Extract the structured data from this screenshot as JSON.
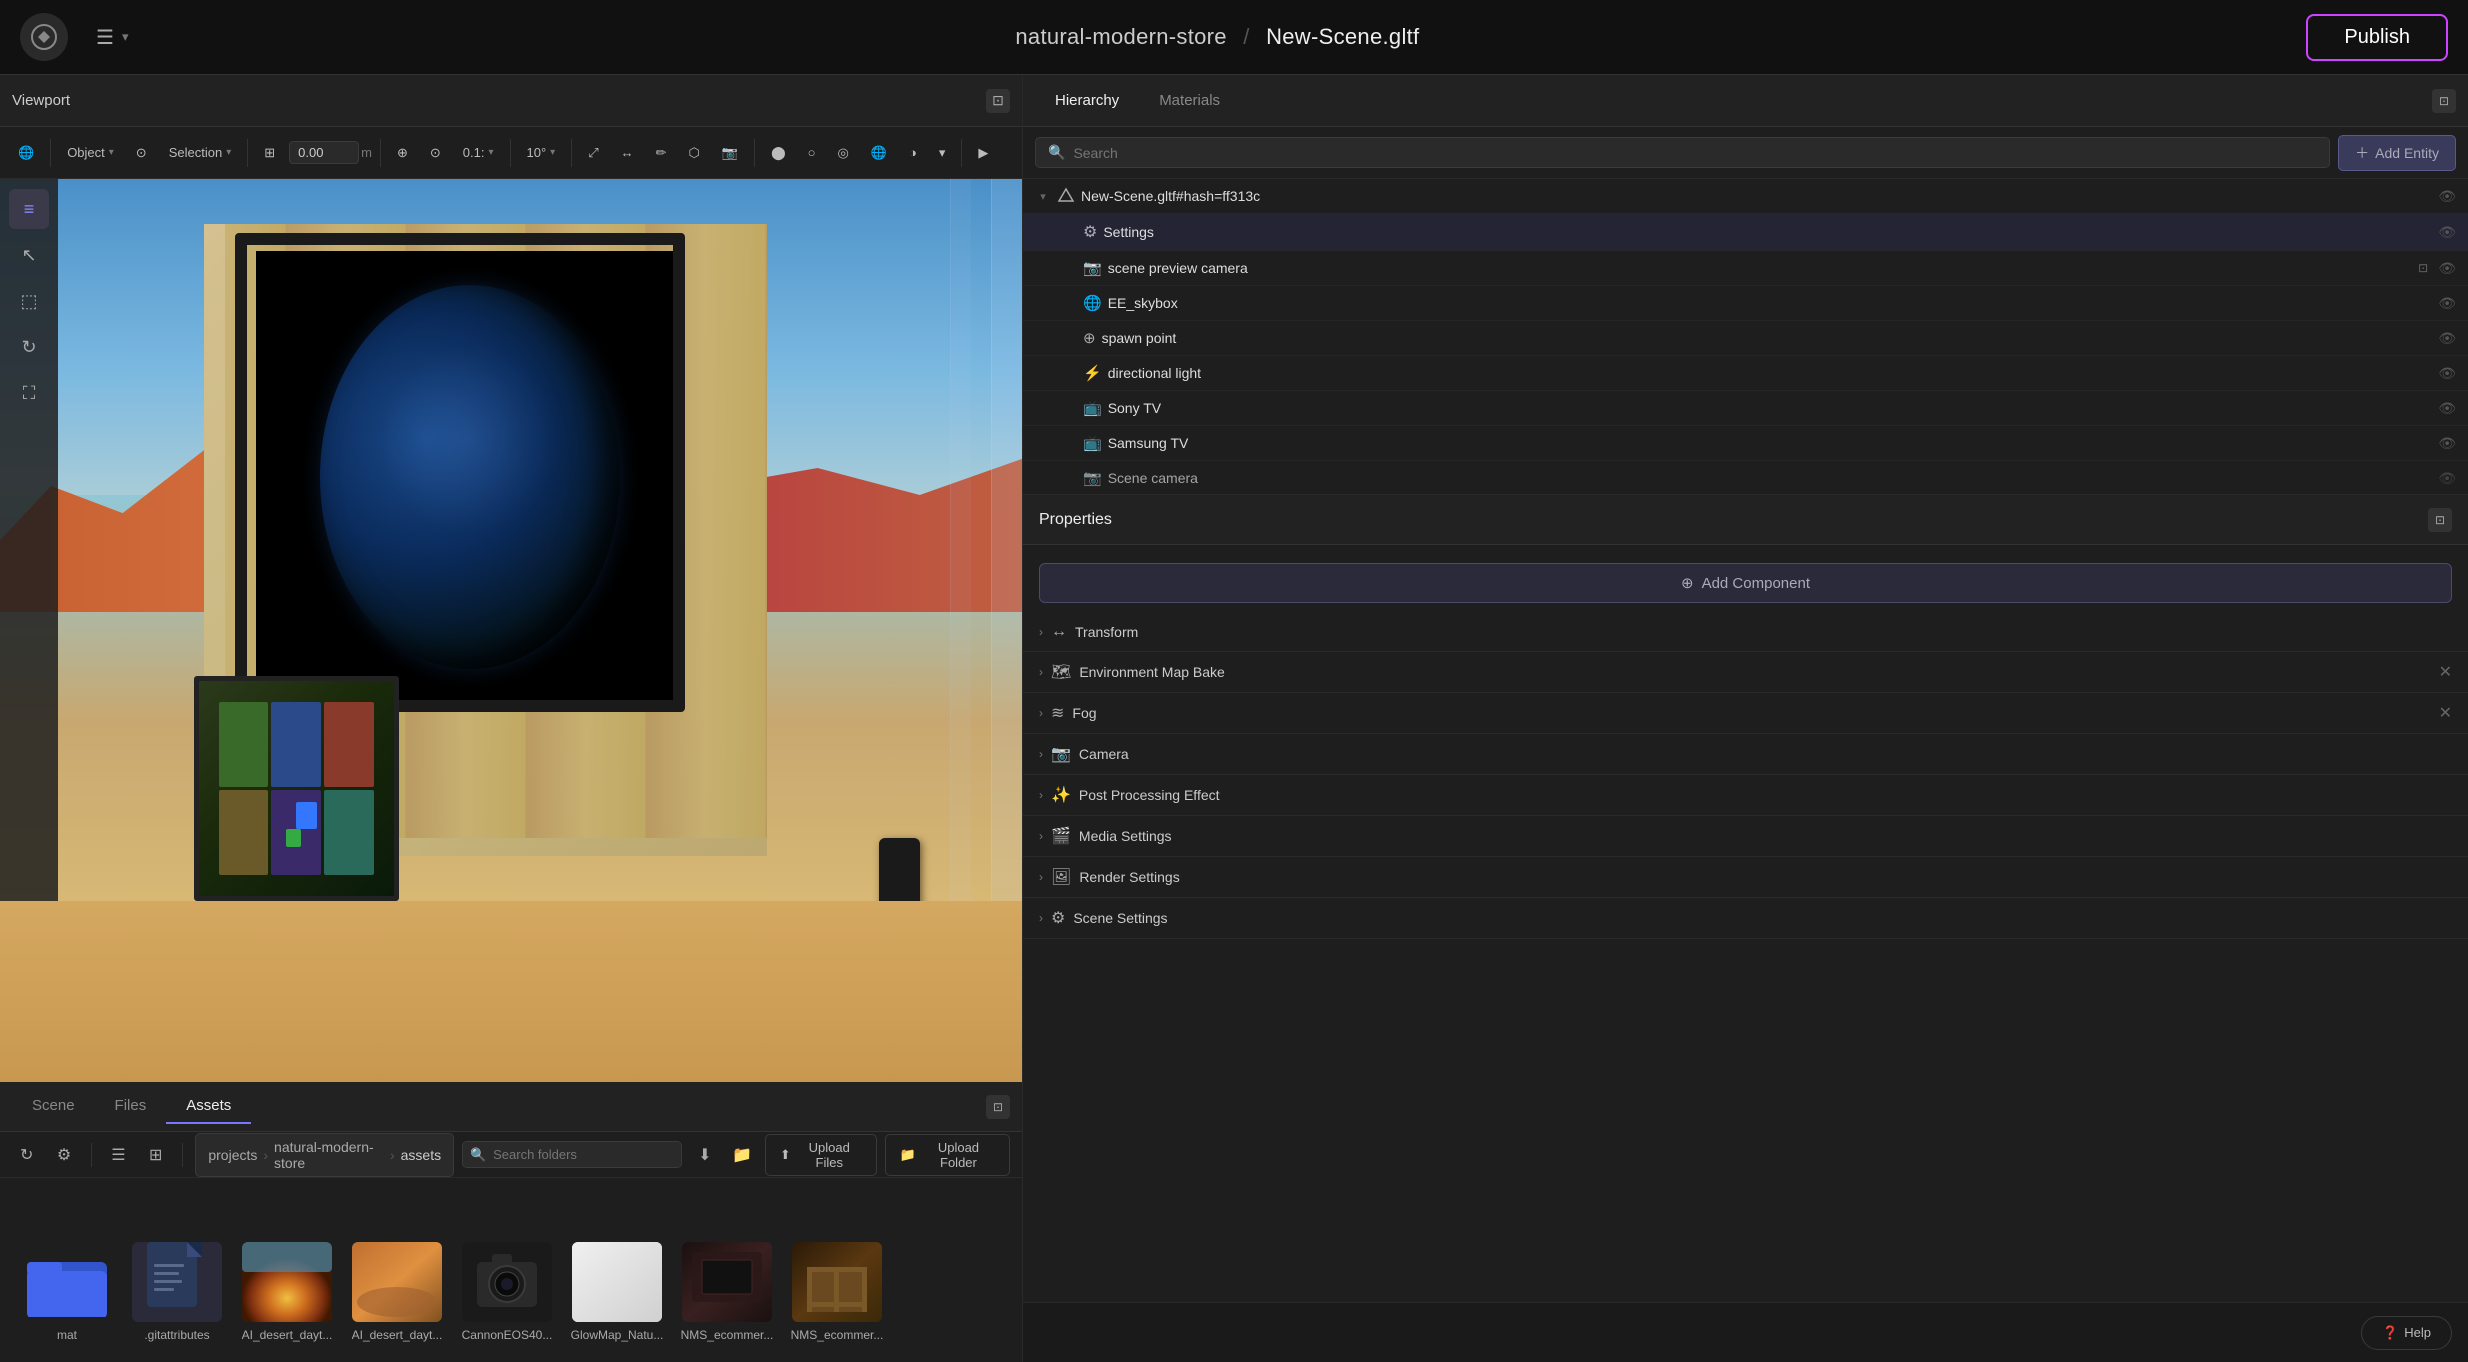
{
  "topbar": {
    "project": "natural-modern-store",
    "separator": "/",
    "scene": "New-Scene.gltf",
    "publish_label": "Publish"
  },
  "viewport": {
    "title": "Viewport",
    "toolbar": {
      "object_mode": "Object",
      "selection": "Selection",
      "position_value": "0.00",
      "position_unit": "m",
      "snap_value": "0.1:",
      "angle_value": "10°"
    },
    "tools": [
      "≡",
      "↖",
      "⬚",
      "↻",
      "⛶"
    ]
  },
  "hierarchy": {
    "tabs": [
      "Hierarchy",
      "Materials"
    ],
    "search_placeholder": "Search",
    "add_entity_label": "Add Entity",
    "items": [
      {
        "level": 0,
        "icon": "📄",
        "label": "New-Scene.gltf#hash=ff313c",
        "eye": true,
        "expanded": true
      },
      {
        "level": 1,
        "icon": "⚙",
        "label": "Settings",
        "eye": true
      },
      {
        "level": 1,
        "icon": "📷",
        "label": "scene preview camera",
        "eye": true,
        "hidden_icon": true
      },
      {
        "level": 1,
        "icon": "🌐",
        "label": "EE_skybox",
        "eye": true
      },
      {
        "level": 1,
        "icon": "⊕",
        "label": "spawn point",
        "eye": true
      },
      {
        "level": 1,
        "icon": "⚡",
        "label": "directional light",
        "eye": true
      },
      {
        "level": 1,
        "icon": "📺",
        "label": "Sony TV",
        "eye": true
      },
      {
        "level": 1,
        "icon": "📺",
        "label": "Samsung TV",
        "eye": true
      },
      {
        "level": 1,
        "icon": "📷",
        "label": "Scene camera",
        "eye": true
      }
    ]
  },
  "properties": {
    "title": "Properties",
    "add_component_label": "Add Component",
    "sections": [
      {
        "id": "transform",
        "icon": "↔",
        "label": "Transform",
        "has_close": false
      },
      {
        "id": "env-map-bake",
        "icon": "🗺",
        "label": "Environment Map Bake",
        "has_close": true
      },
      {
        "id": "fog",
        "icon": "🌫",
        "label": "Fog",
        "has_close": true
      },
      {
        "id": "camera",
        "icon": "📷",
        "label": "Camera",
        "has_close": false
      },
      {
        "id": "post-processing",
        "icon": "✨",
        "label": "Post Processing Effect",
        "has_close": false
      },
      {
        "id": "media-settings",
        "icon": "🎬",
        "label": "Media Settings",
        "has_close": false
      },
      {
        "id": "render-settings",
        "icon": "🖼",
        "label": "Render Settings",
        "has_close": false
      },
      {
        "id": "scene-settings",
        "icon": "⚙",
        "label": "Scene Settings",
        "has_close": false
      }
    ]
  },
  "assets": {
    "tabs": [
      "Scene",
      "Files",
      "Assets"
    ],
    "active_tab": "Assets",
    "toolbar_tools": [
      "↻",
      "⚙",
      "☰",
      "⊞"
    ],
    "breadcrumb": [
      "projects",
      "natural-modern-store",
      "assets"
    ],
    "search_placeholder": "Search folders",
    "upload_files_label": "Upload Files",
    "upload_folder_label": "Upload Folder",
    "items": [
      {
        "type": "folder",
        "label": "mat",
        "color": "#4466ee"
      },
      {
        "type": "file",
        "label": ".gitattributes"
      },
      {
        "type": "img",
        "label": "AI_desert_dayt...",
        "thumb": "desert1"
      },
      {
        "type": "img",
        "label": "AI_desert_dayt...",
        "thumb": "desert2"
      },
      {
        "type": "img",
        "label": "CannonEOS40...",
        "thumb": "camera"
      },
      {
        "type": "img",
        "label": "GlowMap_Natu...",
        "thumb": "glow"
      },
      {
        "type": "img",
        "label": "NMS_ecommer...",
        "thumb": "nms1"
      },
      {
        "type": "img",
        "label": "NMS_ecommer...",
        "thumb": "nms2"
      }
    ]
  },
  "help": {
    "label": "Help"
  }
}
